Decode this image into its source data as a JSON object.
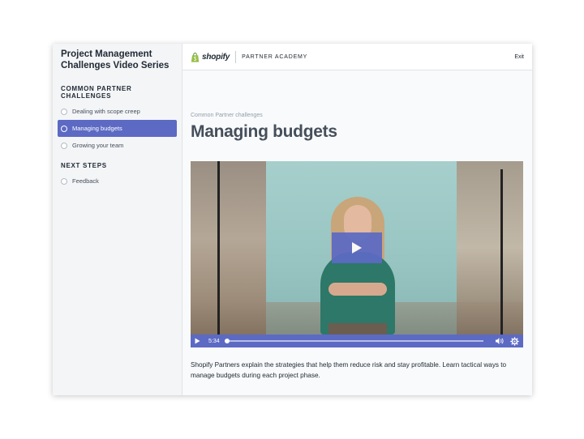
{
  "sidebar": {
    "course_title": "Project Management Challenges Video Series",
    "sections": [
      {
        "heading": "COMMON PARTNER CHALLENGES",
        "lessons": [
          {
            "label": "Dealing with scope creep",
            "active": false
          },
          {
            "label": "Managing budgets",
            "active": true
          },
          {
            "label": "Growing your team",
            "active": false
          }
        ]
      },
      {
        "heading": "NEXT STEPS",
        "lessons": [
          {
            "label": "Feedback",
            "active": false
          }
        ]
      }
    ]
  },
  "header": {
    "logo_text": "shopify",
    "academy_label": "PARTNER ACADEMY",
    "exit_label": "Exit"
  },
  "main": {
    "breadcrumb": "Common Partner challenges",
    "title": "Managing budgets",
    "video": {
      "duration": "5:34",
      "progress": 0
    },
    "description": "Shopify Partners explain the strategies that help them reduce risk and stay profitable. Learn tactical ways to manage budgets during each project phase."
  },
  "colors": {
    "accent": "#5c6ac4",
    "shopify_green": "#95bf47"
  },
  "icons": [
    "shopify-bag-icon",
    "play-icon",
    "volume-icon",
    "settings-gear-icon",
    "radio-icon"
  ]
}
